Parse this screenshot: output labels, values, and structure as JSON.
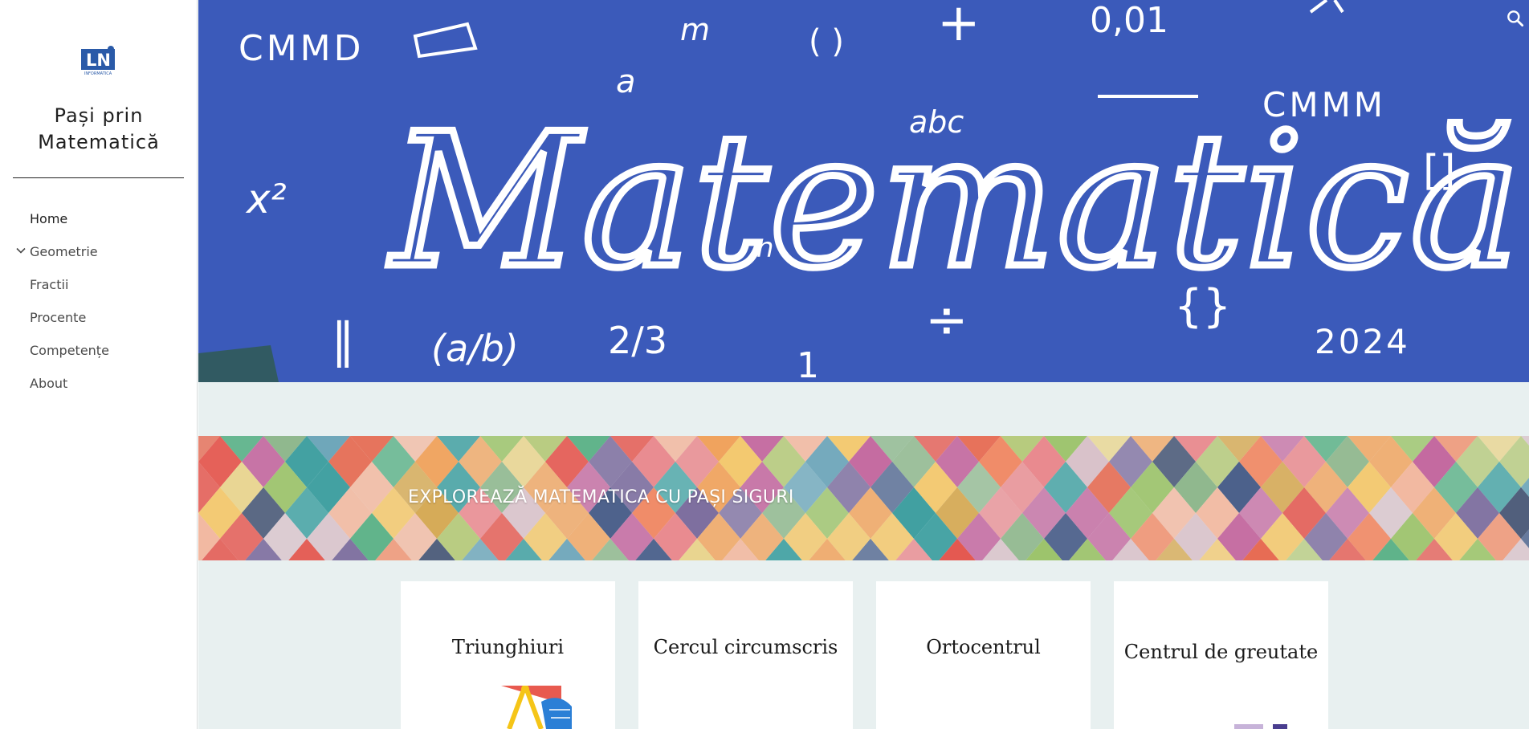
{
  "logo": {
    "text": "LN",
    "subtext": "INFORMATICA"
  },
  "site": {
    "title": "Pași prin\nMatematică"
  },
  "nav": {
    "items": [
      {
        "label": "Home"
      },
      {
        "label": "Geometrie"
      },
      {
        "label": "Fractii"
      },
      {
        "label": "Procente"
      },
      {
        "label": "Competențe"
      },
      {
        "label": "About"
      }
    ]
  },
  "hero": {
    "word": "Matematică",
    "scribbles": [
      "CMMD",
      "CMMM",
      "0,01",
      "abc",
      "x²",
      "2/3",
      "{}",
      "[]",
      "2024",
      "÷",
      "+",
      "( )",
      "a",
      "m",
      "n",
      "1",
      "(a/b)",
      "∥"
    ]
  },
  "banner": {
    "text": "EXPLOREAZĂ MATEMATICA CU PAȘI SIGURI"
  },
  "cards": [
    {
      "title": "Triunghiuri"
    },
    {
      "title": "Cercul circumscris"
    },
    {
      "title": "Ortocentrul"
    },
    {
      "title": "Centrul de greutate"
    }
  ],
  "icons": {
    "search": "search-icon",
    "chevron": "chevron-down-icon"
  },
  "colors": {
    "hero_bg": "#3f5dbe",
    "content_bg": "#e8f0f0",
    "accent": "#2a5aa8"
  }
}
